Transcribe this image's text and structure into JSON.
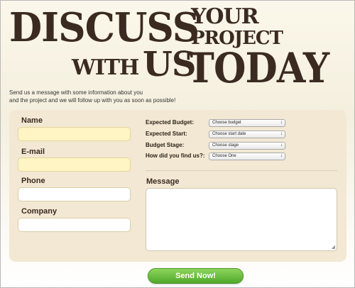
{
  "headline": {
    "discuss": "DISCUSS",
    "your": "YOUR",
    "project": "PROJECT",
    "with": "WITH",
    "us": "US",
    "today": "TODAY"
  },
  "intro": {
    "line1": "Send us a message with some information about you",
    "line2": "and the project and we will follow up with you as soon as possible!"
  },
  "form": {
    "name_label": "Name",
    "email_label": "E-mail",
    "phone_label": "Phone",
    "company_label": "Company",
    "message_label": "Message",
    "name_value": "",
    "email_value": "",
    "phone_value": "",
    "company_value": "",
    "message_value": "",
    "selects": [
      {
        "label": "Expected Budget:",
        "value": "Choose budget"
      },
      {
        "label": "Expected Start:",
        "value": "Choose start date"
      },
      {
        "label": "Budget Stage:",
        "value": "Choose stage"
      },
      {
        "label": "How did you find us?:",
        "value": "Choose One"
      }
    ],
    "submit_label": "Send Now!"
  },
  "colors": {
    "panel": "#f2e8d3",
    "required_field": "#fff4c4",
    "submit_button": "#6cbf43",
    "headline_text": "#3a2a20"
  }
}
